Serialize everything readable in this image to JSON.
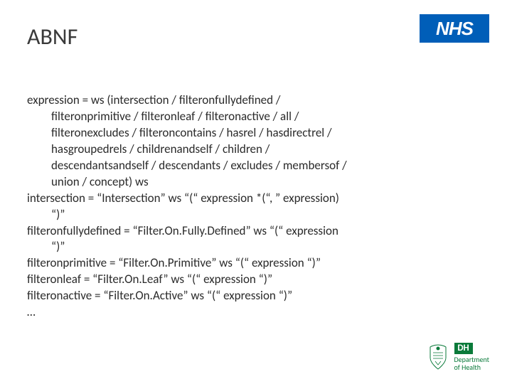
{
  "title": "ABNF",
  "logos": {
    "nhs": "NHS",
    "dh_abbrev": "DH",
    "dh_line1": "Department",
    "dh_line2": "of Health"
  },
  "rules": {
    "expression": {
      "head": "expression = ws (intersection / filteronfullydefined /",
      "cont": [
        "filteronprimitive / filteronleaf / filteronactive / all /",
        "filteronexcludes / filteroncontains / hasrel / hasdirectrel /",
        "hasgroupedrels / childrenandself / children /",
        "descendantsandself / descendants / excludes / membersof /",
        "union / concept) ws"
      ]
    },
    "intersection": {
      "head": "intersection = “Intersection” ws “(“ expression *(“, ” expression)",
      "cont": [
        "“)”"
      ]
    },
    "filteronfullydefined": {
      "head": "filteronfullydefined = “Filter.On.Fully.Defined” ws “(“ expression",
      "cont": [
        "“)”"
      ]
    },
    "filteronprimitive": {
      "head": "filteronprimitive = “Filter.On.Primitive” ws “(“ expression “)”",
      "cont": []
    },
    "filteronleaf": {
      "head": "filteronleaf = “Filter.On.Leaf” ws “(“ expression “)”",
      "cont": []
    },
    "filteronactive": {
      "head": "filteronactive = “Filter.On.Active” ws “(“ expression “)”",
      "cont": []
    },
    "ellipsis": {
      "head": "…",
      "cont": []
    }
  }
}
